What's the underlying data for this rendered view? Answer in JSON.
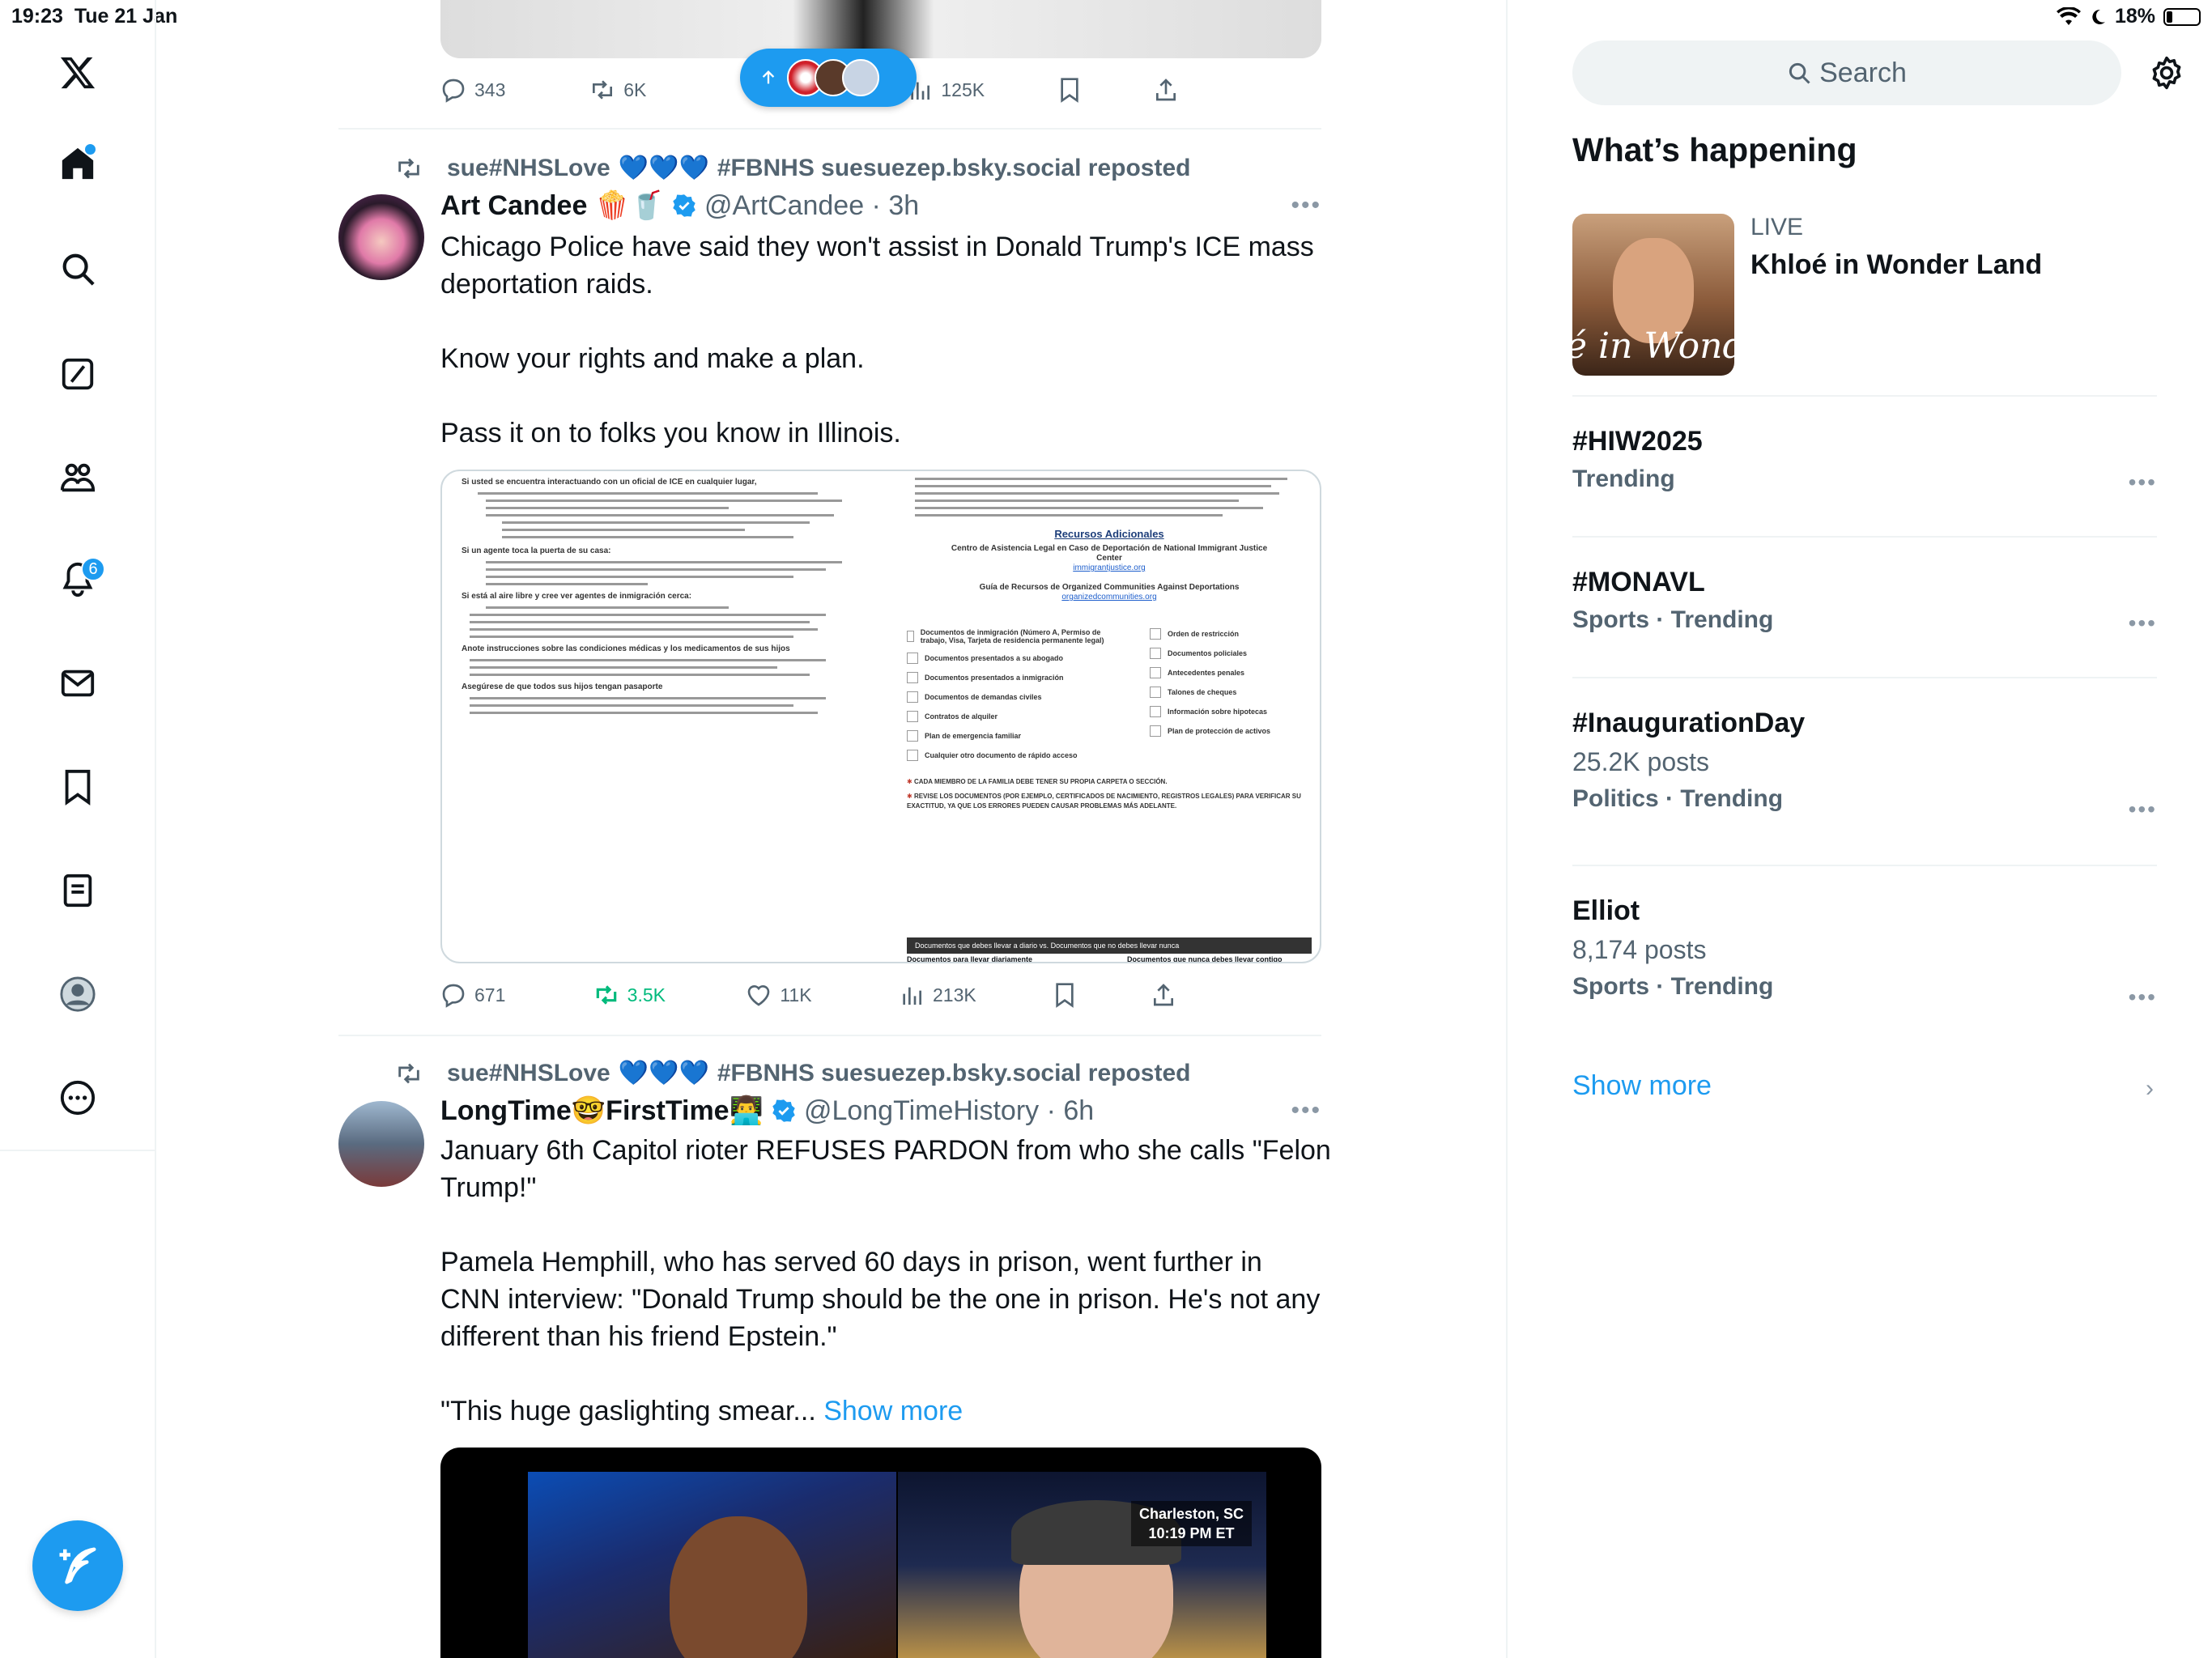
{
  "status": {
    "time": "19:23",
    "date": "Tue 21 Jan",
    "battery": "18%"
  },
  "nav": {
    "notifications_badge": "6",
    "items": [
      "home",
      "explore",
      "grok",
      "communities",
      "notifications",
      "messages",
      "bookmarks",
      "lists",
      "profile",
      "more"
    ]
  },
  "prev_tweet": {
    "replies": "343",
    "reposts": "6K",
    "views": "125K"
  },
  "tweet1": {
    "repost_by_a": "sue#NHSLove",
    "repost_by_b": "#FBNHS suesuezep.bsky.social reposted",
    "name": "Art Candee",
    "name_emoji": "🍿🥤",
    "handle": "@ArtCandee",
    "time": "3h",
    "text": "Chicago Police have said they won't assist in Donald Trump's ICE mass\ndeportation raids.\n\nKnow your rights and make a plan.\n\nPass it on to folks you know in Illinois.",
    "replies": "671",
    "reposts": "3.5K",
    "likes": "11K",
    "views": "213K",
    "image": {
      "left_heading_1": "Si usted se encuentra interactuando con un oficial de ICE en cualquier lugar,",
      "left_heading_2": "Si un agente toca la puerta de su casa:",
      "left_heading_3": "Si está al aire libre y cree ver agentes de inmigración cerca:",
      "left_heading_4": "Anote instrucciones sobre las condiciones médicas y los medicamentos de sus hijos",
      "left_heading_5": "Asegúrese de que todos sus hijos tengan pasaporte",
      "right_title": "Recursos Adicionales",
      "right_org1": "Centro de Asistencia Legal en Caso de Deportación de National Immigrant Justice Center",
      "right_link1": "immigrantjustice.org",
      "right_org2": "Guía de Recursos de Organized Communities Against Deportations",
      "right_link2": "organizedcommunities.org",
      "checklist_left": [
        "Documentos de inmigración (Número A, Permiso de trabajo, Visa, Tarjeta de residencia permanente legal)",
        "Documentos presentados a su abogado",
        "Documentos presentados a inmigración",
        "Documentos de demandas civiles",
        "Contratos de alquiler",
        "Plan de emergencia familiar",
        "Cualquier otro documento de rápido acceso"
      ],
      "checklist_right": [
        "Orden de restricción",
        "Documentos policiales",
        "Antecedentes penales",
        "Talones de cheques",
        "Información sobre hipotecas",
        "Plan de protección de activos"
      ],
      "note1": "CADA MIEMBRO DE LA FAMILIA DEBE TENER SU PROPIA CARPETA O SECCIÓN.",
      "note2": "REVISE LOS DOCUMENTOS (POR EJEMPLO, CERTIFICADOS DE NACIMIENTO, REGISTROS LEGALES) PARA VERIFICAR SU EXACTITUD, YA QUE LOS ERRORES PUEDEN CAUSAR PROBLEMAS MÁS ADELANTE.",
      "bar_text": "Documentos que debes llevar a diario vs. Documentos que no debes llevar nunca",
      "foot_left": "Documentos para llevar diariamente",
      "foot_right": "Documentos que nunca debes llevar contigo"
    }
  },
  "tweet2": {
    "repost_by_a": "sue#NHSLove",
    "repost_by_b": "#FBNHS suesuezep.bsky.social reposted",
    "name_a": "LongTime",
    "name_b": "FirstTime",
    "handle": "@LongTimeHistory",
    "time": "6h",
    "text": "January 6th Capitol rioter REFUSES PARDON from who she calls \"Felon\nTrump!\"\n\nPamela Hemphill, who has served 60 days in prison, went further in\nCNN interview: \"Donald Trump should be the one in prison. He's not any\ndifferent than his friend Epstein.\"\n\n\"This huge gaslighting smear... ",
    "show_more": "Show more",
    "video_location": "Charleston, SC",
    "video_time": "10:19 PM ET"
  },
  "sidebar": {
    "search_placeholder": "Search",
    "title": "What’s happening",
    "live": {
      "label": "LIVE",
      "title": "Khloé in Wonder Land",
      "thumb_text": "é in Wonder L"
    },
    "trends": [
      {
        "tag": "#HIW2025",
        "sub": "",
        "ctx": "Trending"
      },
      {
        "tag": "#MONAVL",
        "sub": "",
        "ctx": "Sports · Trending"
      },
      {
        "tag": "#InaugurationDay",
        "sub": "25.2K posts",
        "ctx": "Politics · Trending"
      },
      {
        "tag": "Elliot",
        "sub": "8,174 posts",
        "ctx": "Sports · Trending"
      }
    ],
    "show_more": "Show more"
  },
  "colors": {
    "accent": "#1d9bf0",
    "muted": "#536471",
    "repost_green": "#00ba7c",
    "border": "#eff3f4"
  }
}
